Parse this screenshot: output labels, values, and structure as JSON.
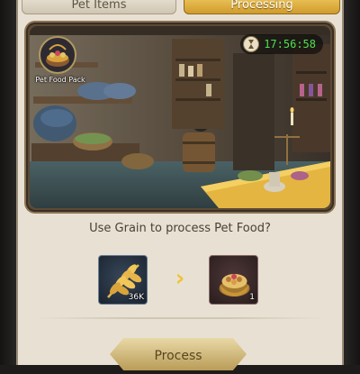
{
  "tabs": {
    "left_label": "Pet Items",
    "right_label": "Processing"
  },
  "scene": {
    "timer": "17:56:58",
    "timer_icon": "hourglass-icon",
    "pack_label": "Pet Food Pack",
    "pack_icon": "pet-food-pack-icon"
  },
  "prompt": {
    "question": "Use Grain to process Pet Food?"
  },
  "items": {
    "input_icon": "grain-icon",
    "input_count": "36K",
    "output_icon": "pet-food-bowl-icon",
    "output_count": "1",
    "arrow_icon": "chevron-right-icon"
  },
  "actions": {
    "process_label": "Process"
  },
  "colors": {
    "accent_gold": "#f0c23b",
    "timer_green": "#4ee24e",
    "panel": "#e8e1d3"
  }
}
